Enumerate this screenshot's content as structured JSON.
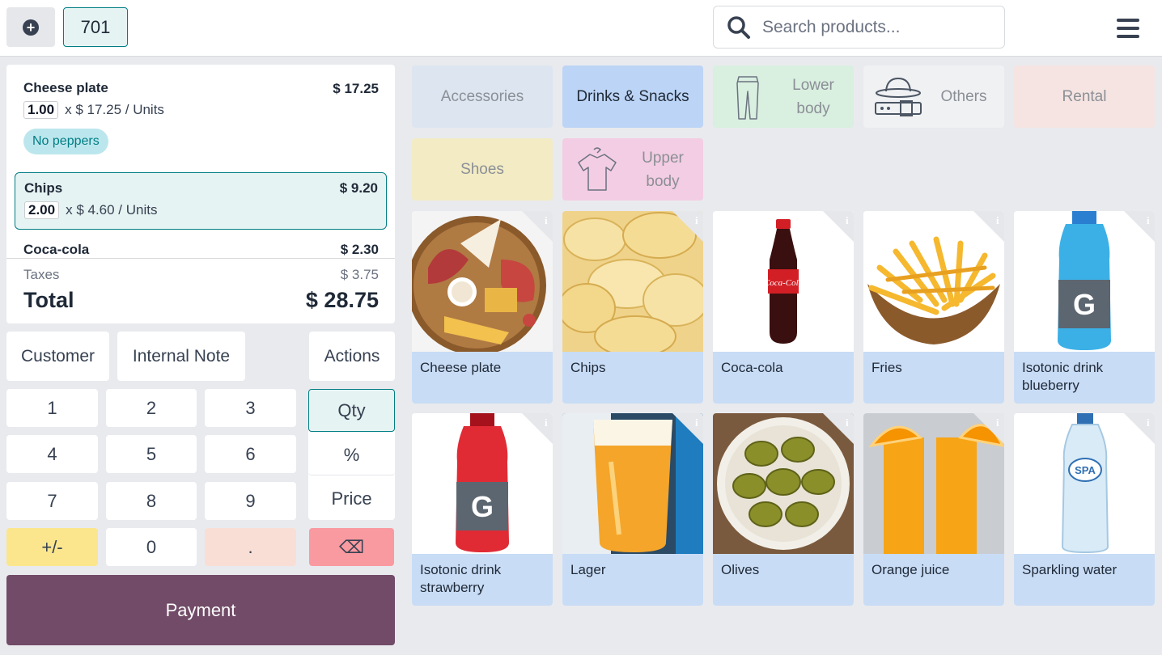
{
  "topbar": {
    "order_number": "701",
    "search_placeholder": "Search products..."
  },
  "order": {
    "lines": [
      {
        "name": "Cheese plate",
        "qty": "1.00",
        "unit_text": "x $ 17.25 / Units",
        "price": "$ 17.25",
        "note": "No peppers"
      },
      {
        "name": "Chips",
        "qty": "2.00",
        "unit_text": "x $ 4.60 / Units",
        "price": "$ 9.20"
      },
      {
        "name": "Coca-cola",
        "price": "$ 2.30"
      }
    ],
    "taxes_label": "Taxes",
    "taxes_value": "$ 3.75",
    "total_label": "Total",
    "total_value": "$ 28.75"
  },
  "controls": {
    "customer": "Customer",
    "internal_note": "Internal Note",
    "actions": "Actions"
  },
  "numpad": {
    "digits": [
      "1",
      "2",
      "3",
      "4",
      "5",
      "6",
      "7",
      "8",
      "9",
      "0"
    ],
    "plus_minus": "+/-",
    "dot": ".",
    "backspace": "⌫",
    "modes": {
      "qty": "Qty",
      "percent": "%",
      "price": "Price"
    },
    "active_mode": "Qty"
  },
  "payment_label": "Payment",
  "categories": [
    {
      "label": "Accessories",
      "color": "#dde5f0"
    },
    {
      "label": "Drinks & Snacks",
      "color": "#bcd4f5",
      "active": true
    },
    {
      "label_lines": [
        "Lower",
        "body"
      ],
      "color": "#d9efe0",
      "icon": "pants-icon"
    },
    {
      "label": "Others",
      "color": "#f0f1f3",
      "icon": "hat-and-belt-icon"
    },
    {
      "label": "Rental",
      "color": "#f5e4e1"
    },
    {
      "label": "Shoes",
      "color": "#f2ebc4"
    },
    {
      "label_lines": [
        "Upper",
        "body"
      ],
      "color": "#f3cde3",
      "icon": "shirt-icon"
    }
  ],
  "products": [
    {
      "name": "Cheese plate"
    },
    {
      "name": "Chips"
    },
    {
      "name": "Coca-cola"
    },
    {
      "name": "Fries"
    },
    {
      "name_lines": [
        "Isotonic drink",
        "blueberry"
      ]
    },
    {
      "name_lines": [
        "Isotonic drink",
        "strawberry"
      ]
    },
    {
      "name": "Lager"
    },
    {
      "name": "Olives"
    },
    {
      "name": "Orange juice"
    },
    {
      "name": "Sparkling water"
    }
  ],
  "colors": {
    "brand": "#714b67",
    "accent": "#017e84"
  }
}
